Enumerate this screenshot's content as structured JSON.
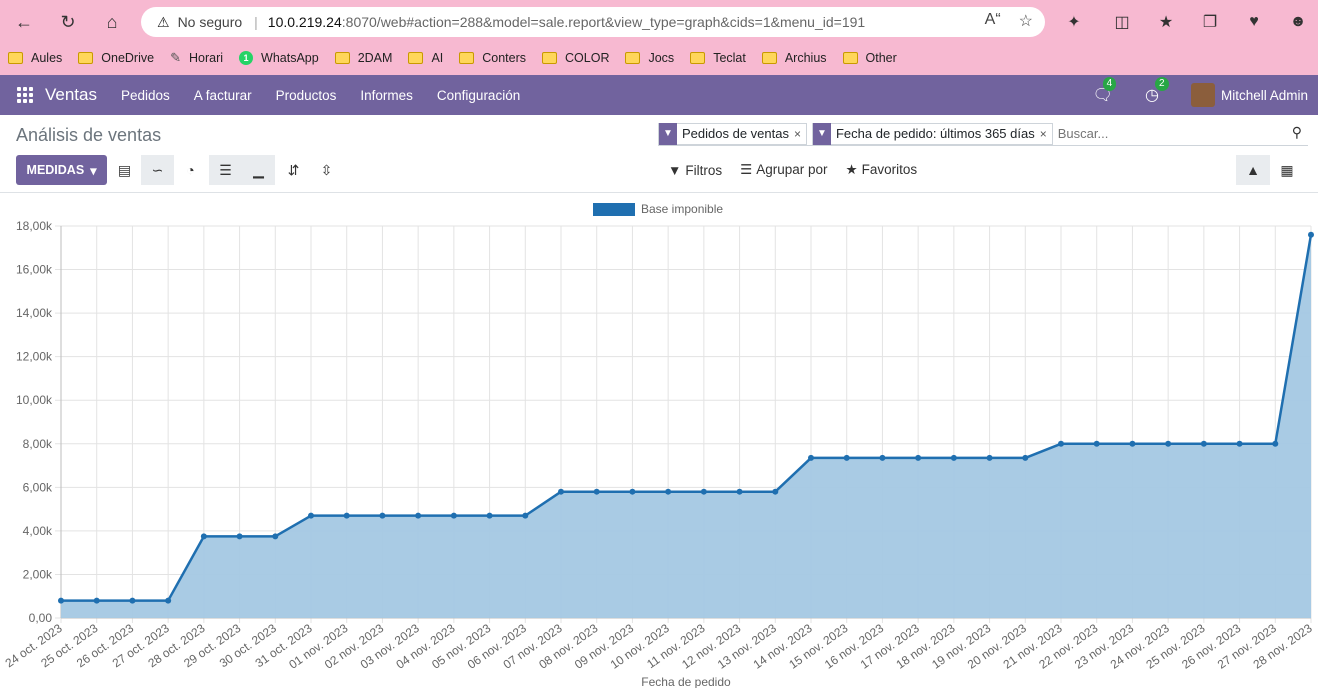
{
  "browser": {
    "security_label": "No seguro",
    "url_host": "10.0.219.24",
    "url_path": ":8070/web#action=288&model=sale.report&view_type=graph&cids=1&menu_id=191",
    "bookmarks": [
      "Aules",
      "OneDrive",
      "Horari",
      "WhatsApp",
      "2DAM",
      "AI",
      "Conters",
      "COLOR",
      "Jocs",
      "Teclat",
      "Archius",
      "Other"
    ],
    "whatsapp_badge": "1"
  },
  "nav": {
    "brand": "Ventas",
    "menu": [
      "Pedidos",
      "A facturar",
      "Productos",
      "Informes",
      "Configuración"
    ],
    "messages_count": "4",
    "activities_count": "2",
    "user": "Mitchell Admin",
    "accent": "#71639e"
  },
  "control_panel": {
    "title": "Análisis de ventas",
    "facets": [
      "Pedidos de ventas",
      "Fecha de pedido: últimos 365 días"
    ],
    "search_placeholder": "Buscar...",
    "measures_label": "MEDIDAS",
    "filters_label": "Filtros",
    "groupby_label": "Agrupar por",
    "favorites_label": "Favoritos"
  },
  "chart_data": {
    "type": "area",
    "series": [
      {
        "name": "Base imponible",
        "values": [
          800,
          800,
          800,
          800,
          3750,
          3750,
          3750,
          4700,
          4700,
          4700,
          4700,
          4700,
          4700,
          4700,
          5800,
          5800,
          5800,
          5800,
          5800,
          5800,
          5800,
          7350,
          7350,
          7350,
          7350,
          7350,
          7350,
          7350,
          8000,
          8000,
          8000,
          8000,
          8000,
          8000,
          8000,
          17600
        ]
      }
    ],
    "categories": [
      "24 oct. 2023",
      "25 oct. 2023",
      "26 oct. 2023",
      "27 oct. 2023",
      "28 oct. 2023",
      "29 oct. 2023",
      "30 oct. 2023",
      "31 oct. 2023",
      "01 nov. 2023",
      "02 nov. 2023",
      "03 nov. 2023",
      "04 nov. 2023",
      "05 nov. 2023",
      "06 nov. 2023",
      "07 nov. 2023",
      "08 nov. 2023",
      "09 nov. 2023",
      "10 nov. 2023",
      "11 nov. 2023",
      "12 nov. 2023",
      "13 nov. 2023",
      "14 nov. 2023",
      "15 nov. 2023",
      "16 nov. 2023",
      "17 nov. 2023",
      "18 nov. 2023",
      "19 nov. 2023",
      "20 nov. 2023",
      "21 nov. 2023",
      "22 nov. 2023",
      "23 nov. 2023",
      "24 nov. 2023",
      "25 nov. 2023",
      "26 nov. 2023",
      "27 nov. 2023",
      "28 nov. 2023"
    ],
    "ytick_labels": [
      "0,00",
      "2,00k",
      "4,00k",
      "6,00k",
      "8,00k",
      "10,00k",
      "12,00k",
      "14,00k",
      "16,00k",
      "18,00k"
    ],
    "ylim": [
      0,
      18000
    ],
    "xlabel": "Fecha de pedido",
    "legend_position": "top-center",
    "grid": true,
    "line_color": "#1f6fb0",
    "fill_color": "#a4c8e3"
  }
}
